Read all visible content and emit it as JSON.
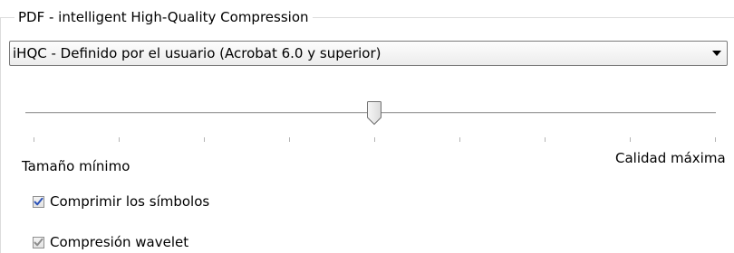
{
  "group": {
    "title": "PDF - intelligent High-Quality Compression"
  },
  "preset": {
    "selected": "iHQC - Definido por el usuario (Acrobat 6.0 y superior)"
  },
  "quality_slider": {
    "min_label": "Tamaño mínimo",
    "max_label": "Calidad máxima",
    "value_fraction": 0.5,
    "tick_count": 9
  },
  "options": [
    {
      "label": "Comprimir los símbolos",
      "checked": true,
      "enabled": true
    },
    {
      "label": "Compresión wavelet",
      "checked": true,
      "enabled": false
    }
  ],
  "colors": {
    "check_mark": "#2b52b8",
    "check_mark_disabled": "#8c8c8c"
  }
}
